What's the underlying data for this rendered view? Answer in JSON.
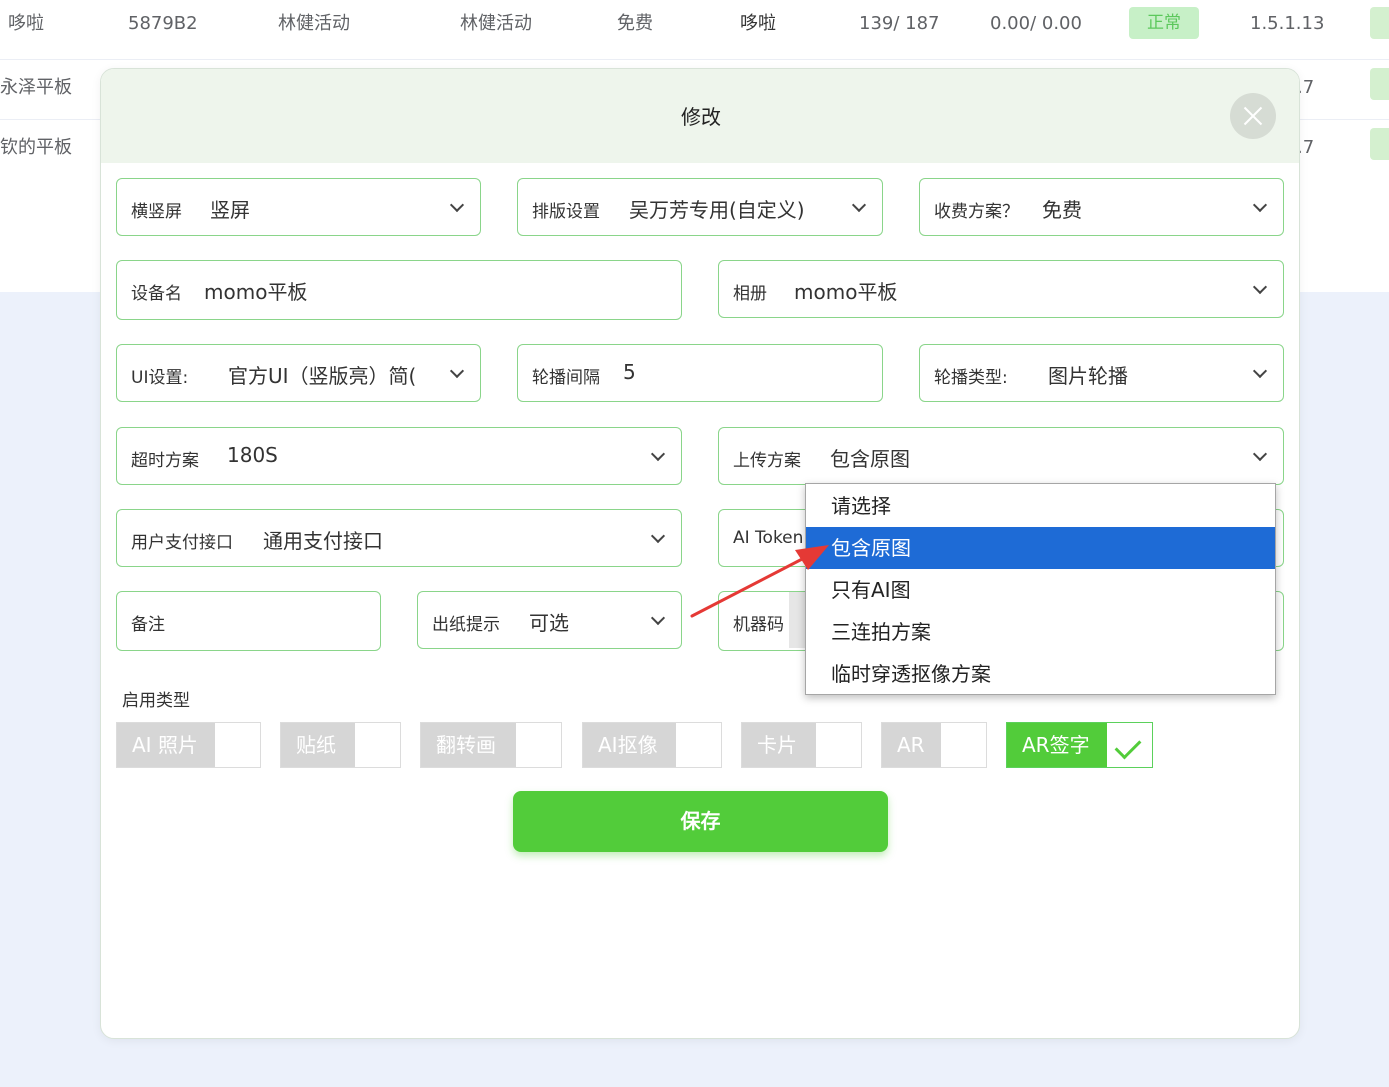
{
  "background_table": {
    "rows": [
      {
        "cells": [
          "哆啦",
          "5879B2",
          "林健活动",
          "林健活动",
          "免费",
          "哆啦",
          "139/ 187",
          "0.00/ 0.00"
        ],
        "status": "正常",
        "version": "1.5.1.13"
      },
      {
        "cells": [
          "永泽平板"
        ],
        "version_tail": ".7"
      },
      {
        "cells": [
          "钦的平板"
        ],
        "version_tail": ".7"
      }
    ]
  },
  "modal": {
    "title": "修改",
    "fields": {
      "orientation": {
        "label": "横竖屏",
        "value": "竖屏"
      },
      "layout": {
        "label": "排版设置",
        "value": "吴万芳专用(自定义)"
      },
      "billing": {
        "label": "收费方案？",
        "value": "免费"
      },
      "device_name": {
        "label": "设备名",
        "value": "momo平板"
      },
      "album": {
        "label": "相册",
        "value": "momo平板"
      },
      "ui_setting": {
        "label": "UI设置:",
        "value": "官方UI（竖版亮）简("
      },
      "carousel_interval": {
        "label": "轮播间隔",
        "value": "5"
      },
      "carousel_type": {
        "label": "轮播类型:",
        "value": "图片轮播"
      },
      "timeout": {
        "label": "超时方案",
        "value": "180S"
      },
      "upload": {
        "label": "上传方案",
        "value": "包含原图"
      },
      "payment": {
        "label": "用户支付接口",
        "value": "通用支付接口"
      },
      "ai_token": {
        "label": "AI Token"
      },
      "remark": {
        "label": "备注"
      },
      "paper_tip": {
        "label": "出纸提示",
        "value": "可选"
      },
      "machine_code": {
        "label": "机器码"
      }
    },
    "enable_types_label": "启用类型",
    "enable_types": [
      {
        "label": "AI 照片",
        "checked": false
      },
      {
        "label": "贴纸",
        "checked": false
      },
      {
        "label": "翻转画",
        "checked": false
      },
      {
        "label": "AI抠像",
        "checked": false
      },
      {
        "label": "卡片",
        "checked": false
      },
      {
        "label": "AR",
        "checked": false
      },
      {
        "label": "AR签字",
        "checked": true
      }
    ],
    "save_label": "保存"
  },
  "upload_dropdown": {
    "options": [
      "请选择",
      "包含原图",
      "只有AI图",
      "三连拍方案",
      "临时穿透抠像方案"
    ],
    "selected": "包含原图"
  },
  "colors": {
    "accent_green": "#52cc3a",
    "selected_blue": "#1e6bd6",
    "annotation_arrow": "#e53935"
  }
}
